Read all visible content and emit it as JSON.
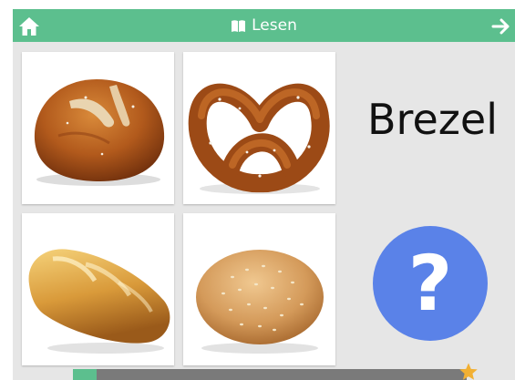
{
  "header": {
    "title": "Lesen",
    "home_icon": "home-icon",
    "title_icon": "book-icon",
    "next_icon": "arrow-right-icon"
  },
  "cards": [
    {
      "item": "bread-loaf-image"
    },
    {
      "item": "pretzel-image"
    },
    {
      "item": "baguette-roll-image"
    },
    {
      "item": "sesame-bun-image"
    }
  ],
  "word": "Brezel",
  "help_button": {
    "label": "?"
  },
  "progress": {
    "fraction": 0.06,
    "end_icon": "star-icon"
  },
  "colors": {
    "header": "#5cbf8e",
    "background": "#e6e6e6",
    "help_button": "#5a82e8",
    "progress_track": "#7a7a7a",
    "progress_fill": "#5cbf8e",
    "star": "#f2b033"
  }
}
